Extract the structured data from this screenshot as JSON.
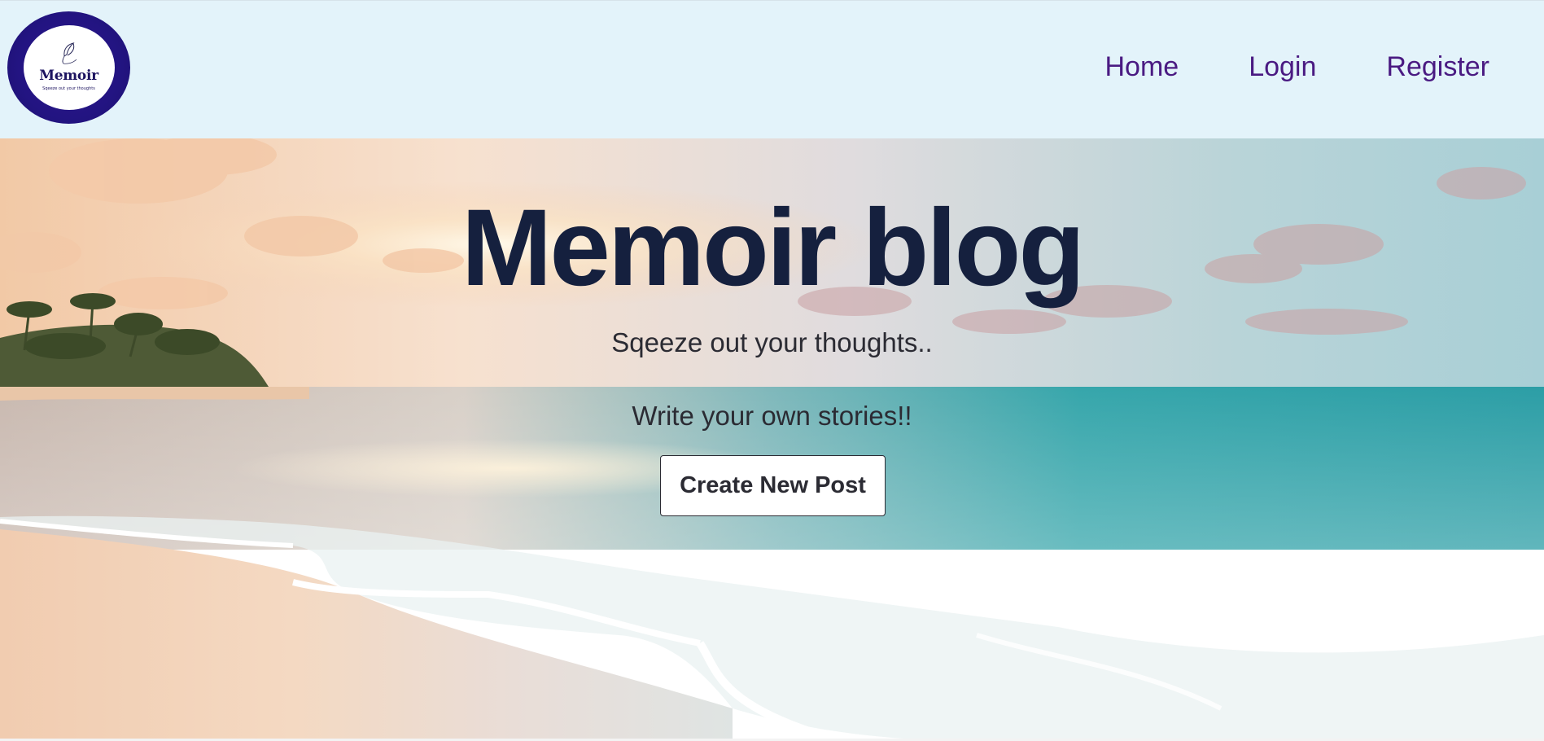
{
  "navbar": {
    "logo": {
      "name": "Memoir",
      "tagline": "Sqeeze out your thoughts",
      "icon": "feather-icon"
    },
    "links": [
      {
        "label": "Home"
      },
      {
        "label": "Login"
      },
      {
        "label": "Register"
      }
    ],
    "link_color": "#4a1a82",
    "background": "#e3f3fa"
  },
  "hero": {
    "title": "Memoir blog",
    "subtitle": "Sqeeze out your thoughts..",
    "tagline": "Write your own stories!!",
    "cta_label": "Create New Post",
    "title_color": "#15203e",
    "background_image": "beach-sunset-image"
  }
}
